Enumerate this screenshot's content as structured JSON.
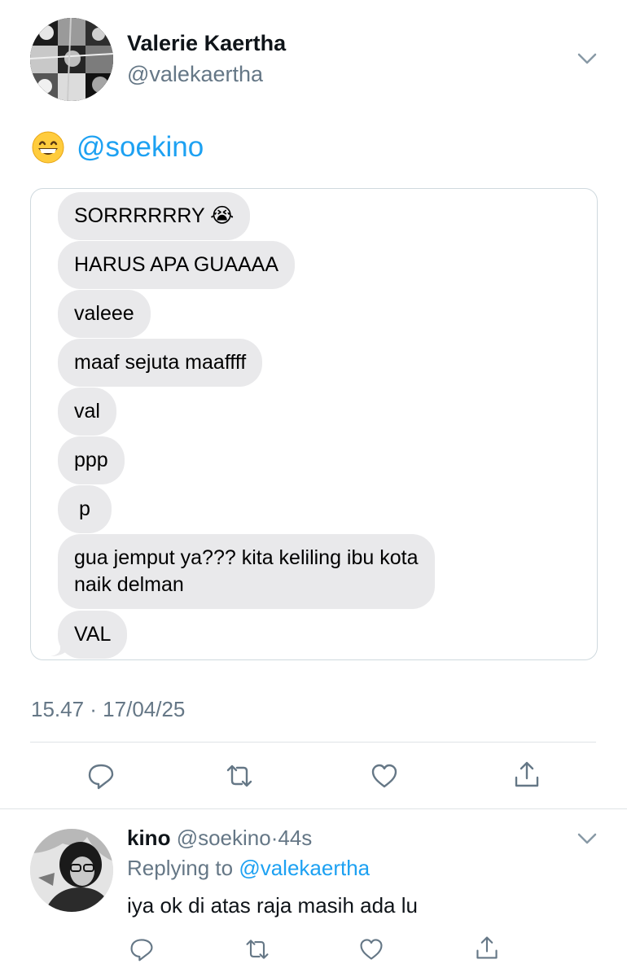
{
  "tweet": {
    "author": {
      "name": "Valerie Kaertha",
      "handle": "@valekaertha"
    },
    "text": {
      "emoji": "grinning-face-with-smiling-eyes",
      "mention": "@soekino"
    },
    "timestamp": "15.47 · 17/04/25",
    "screenshot_messages": [
      "SORRRRRRY 😭",
      "HARUS APA GUAAAA",
      "valeee",
      "maaf sejuta maaffff",
      "val",
      "ppp",
      "p",
      "gua jemput ya??? kita keliling ibu kota naik delman",
      "VAL"
    ],
    "actions": [
      "reply-icon",
      "retweet-icon",
      "like-icon",
      "share-icon"
    ]
  },
  "reply": {
    "name": "kino",
    "handle": "@soekino",
    "separator": "·",
    "time": "44s",
    "replying_prefix": "Replying to",
    "replying_to": "@valekaertha",
    "text": "iya ok di atas raja masih ada lu",
    "actions": [
      "reply-icon",
      "retweet-icon",
      "like-icon",
      "share-icon"
    ]
  },
  "colors": {
    "link": "#1da1f2",
    "secondary_text": "#657786",
    "bubble": "#e9e9eb",
    "divider": "#dfe3e6"
  }
}
